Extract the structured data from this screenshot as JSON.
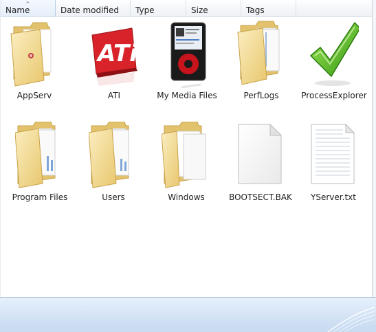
{
  "columns": [
    {
      "label": "Name",
      "sort_arrow": "^"
    },
    {
      "label": "Date modified"
    },
    {
      "label": "Type"
    },
    {
      "label": "Size"
    },
    {
      "label": "Tags"
    }
  ],
  "files": [
    {
      "name": "AppServ",
      "icon": "folder-icon"
    },
    {
      "name": "ATI",
      "icon": "ati-logo-icon"
    },
    {
      "name": "My Media Files",
      "icon": "media-player-icon"
    },
    {
      "name": "PerfLogs",
      "icon": "folder-icon"
    },
    {
      "name": "ProcessExplorer",
      "icon": "checkmark-icon"
    },
    {
      "name": "Program Files",
      "icon": "folder-icon"
    },
    {
      "name": "Users",
      "icon": "folder-icon"
    },
    {
      "name": "Windows",
      "icon": "folder-icon"
    },
    {
      "name": "BOOTSECT.BAK",
      "icon": "blank-file-icon"
    },
    {
      "name": "YServer.txt",
      "icon": "text-file-icon"
    }
  ],
  "colors": {
    "folder": "#f2d98a",
    "folder_dark": "#d9b65a",
    "ati_red": "#d8232a",
    "check_green": "#4cb81e",
    "status_bar": "#d2e2f5"
  }
}
